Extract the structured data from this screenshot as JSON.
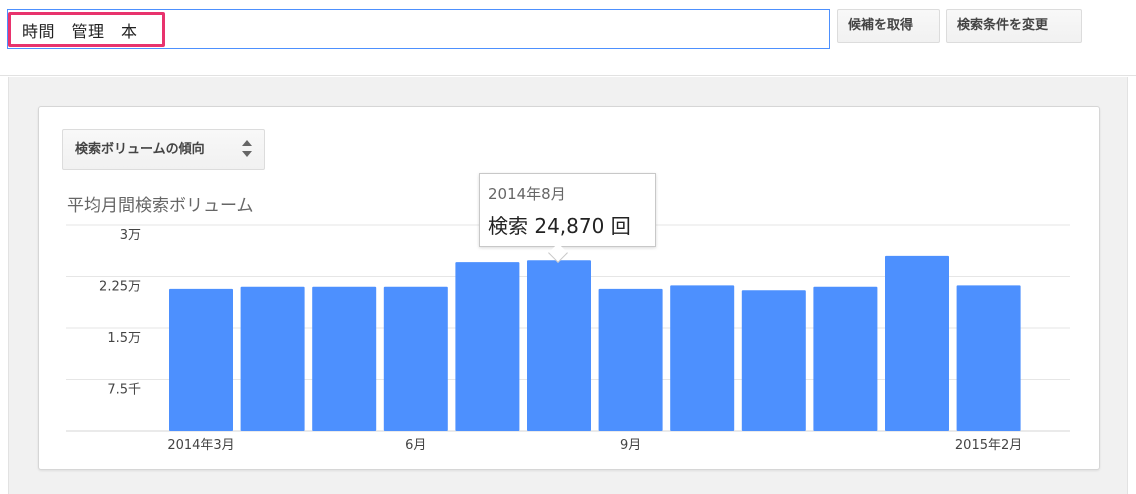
{
  "search": {
    "query": "時間　管理　本",
    "get_candidates_label": "候補を取得",
    "change_conditions_label": "検索条件を変更"
  },
  "metric_selector": {
    "selected": "検索ボリュームの傾向",
    "icon": "sort-arrows-icon"
  },
  "chart_data": {
    "type": "bar",
    "title": "平均月間検索ボリューム",
    "color": "#4d90fe",
    "ylim": [
      0,
      30000
    ],
    "yticks": [
      {
        "value": 7500,
        "label": "7.5千"
      },
      {
        "value": 15000,
        "label": "1.5万"
      },
      {
        "value": 22500,
        "label": "2.25万"
      },
      {
        "value": 30000,
        "label": "3万"
      }
    ],
    "categories": [
      "2014-03",
      "2014-04",
      "2014-05",
      "2014-06",
      "2014-07",
      "2014-08",
      "2014-09",
      "2014-10",
      "2014-11",
      "2014-12",
      "2015-01",
      "2015-02"
    ],
    "x_tick_labels": [
      {
        "index": 0,
        "label": "2014年3月"
      },
      {
        "index": 3,
        "label": "6月"
      },
      {
        "index": 6,
        "label": "9月"
      },
      {
        "index": 11,
        "label": "2015年2月"
      }
    ],
    "values": [
      20700,
      21000,
      21000,
      21000,
      24600,
      24870,
      20700,
      21200,
      20500,
      21000,
      25500,
      21200
    ],
    "grid": true,
    "tooltip": {
      "index": 5,
      "month": "2014年8月",
      "text": "検索 24,870 回"
    }
  }
}
